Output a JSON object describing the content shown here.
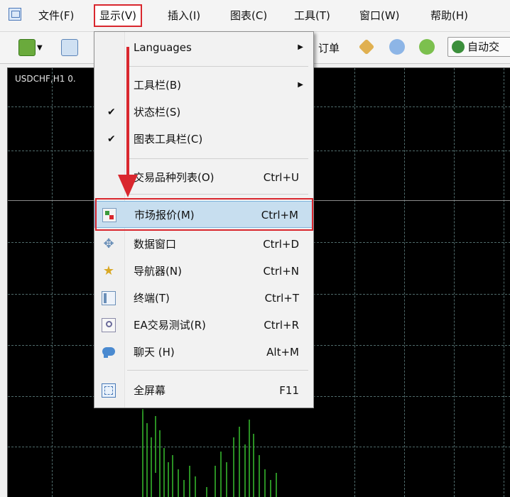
{
  "menubar": {
    "items": [
      {
        "label": "文件(F)"
      },
      {
        "label": "显示(V)"
      },
      {
        "label": "插入(I)"
      },
      {
        "label": "图表(C)"
      },
      {
        "label": "工具(T)"
      },
      {
        "label": "窗口(W)"
      },
      {
        "label": "帮助(H)"
      }
    ]
  },
  "toolbar": {
    "new_order_fragment": "订单",
    "auto_trading_fragment": "自动交"
  },
  "chart": {
    "title": "USDCHF,H1  0."
  },
  "dropdown": {
    "languages": {
      "label": "Languages"
    },
    "toolbars": {
      "label": "工具栏(B)"
    },
    "statusbar": {
      "label": "状态栏(S)"
    },
    "chart_toolbar": {
      "label": "图表工具栏(C)"
    },
    "symbols": {
      "label": "交易品种列表(O)",
      "shortcut": "Ctrl+U"
    },
    "market_watch": {
      "label": "市场报价(M)",
      "shortcut": "Ctrl+M"
    },
    "data_window": {
      "label": "数据窗口",
      "shortcut": "Ctrl+D"
    },
    "navigator": {
      "label": "导航器(N)",
      "shortcut": "Ctrl+N"
    },
    "terminal": {
      "label": "终端(T)",
      "shortcut": "Ctrl+T"
    },
    "strategy_tester": {
      "label": "EA交易测试(R)",
      "shortcut": "Ctrl+R"
    },
    "chat": {
      "label": "聊天 (H)",
      "shortcut": "Alt+M"
    },
    "fullscreen": {
      "label": "全屏幕",
      "shortcut": "F11"
    }
  },
  "colors": {
    "highlight_border": "#d9272e",
    "menu_selection": "#c7deef",
    "chart_background": "#000000",
    "candles": "#38c12f"
  }
}
